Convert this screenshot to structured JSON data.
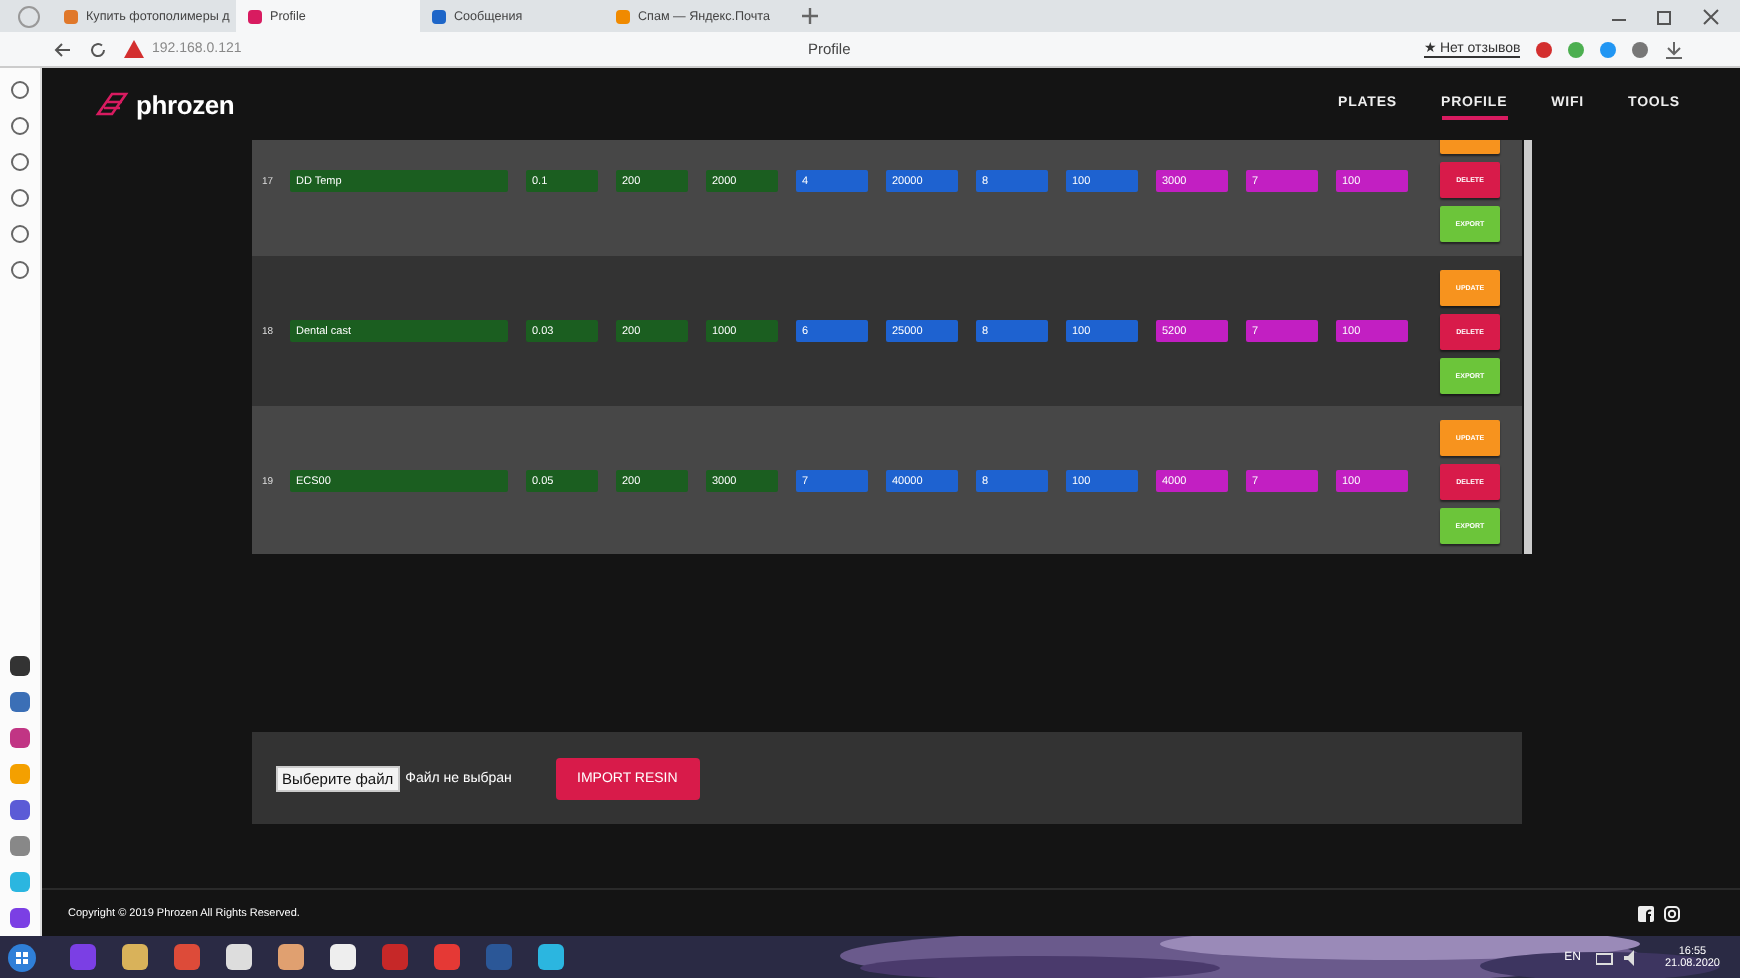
{
  "browser": {
    "tabs": [
      {
        "label": "Купить фотополимеры д",
        "selected": false,
        "kind": "shop"
      },
      {
        "label": "Profile",
        "selected": true,
        "kind": "phrozen"
      },
      {
        "label": "Сообщения",
        "selected": false,
        "kind": "messages"
      },
      {
        "label": "Спам — Яндекс.Почта",
        "selected": false,
        "kind": "mail"
      }
    ],
    "address": "192.168.0.121",
    "page_title": "Profile",
    "reviews": "★ Нет отзывов"
  },
  "header": {
    "logo": "phrozen",
    "nav": [
      {
        "label": "PLATES",
        "selected": false
      },
      {
        "label": "PROFILE",
        "selected": true
      },
      {
        "label": "WIFI",
        "selected": false
      },
      {
        "label": "TOOLS",
        "selected": false
      }
    ]
  },
  "rows": [
    {
      "number": "17",
      "name": "DD Temp",
      "values": [
        "0.1",
        "200",
        "2000",
        "4",
        "20000",
        "8",
        "100",
        "3000",
        "7",
        "100"
      ],
      "actions": [
        {
          "kind": "update",
          "cut": true
        },
        {
          "kind": "delete",
          "label": "DELETE"
        },
        {
          "kind": "export",
          "label": "EXPORT"
        }
      ]
    },
    {
      "number": "18",
      "name": "Dental cast",
      "values": [
        "0.03",
        "200",
        "1000",
        "6",
        "25000",
        "8",
        "100",
        "5200",
        "7",
        "100"
      ],
      "actions": [
        {
          "kind": "update",
          "label": "UPDATE"
        },
        {
          "kind": "delete",
          "label": "DELETE"
        },
        {
          "kind": "export",
          "label": "EXPORT"
        }
      ]
    },
    {
      "number": "19",
      "name": "ECS00",
      "values": [
        "0.05",
        "200",
        "3000",
        "7",
        "40000",
        "8",
        "100",
        "4000",
        "7",
        "100"
      ],
      "actions": [
        {
          "kind": "update",
          "label": "UPDATE"
        },
        {
          "kind": "delete",
          "label": "DELETE"
        },
        {
          "kind": "export",
          "label": "EXPORT"
        }
      ]
    }
  ],
  "import": {
    "file_button": "Выберите файл",
    "file_status": "Файл не выбран",
    "button": "IMPORT RESIN"
  },
  "footer": {
    "copyright": "Copyright © 2019 Phrozen All Rights Reserved."
  },
  "taskbar": {
    "language": "EN",
    "time": "16:55",
    "date": "21.08.2020"
  }
}
